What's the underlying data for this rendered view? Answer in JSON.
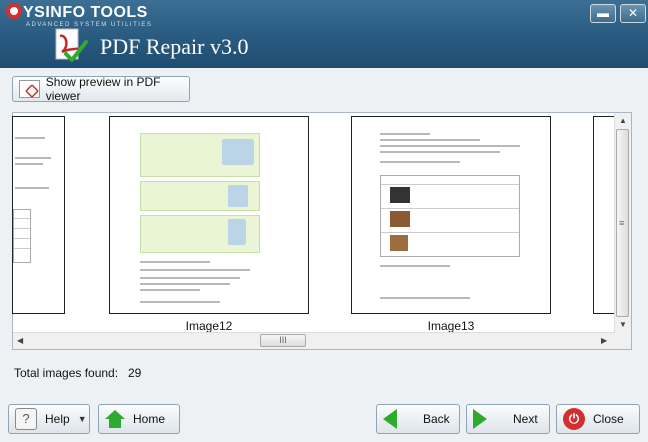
{
  "header": {
    "brand": "YSINFO TOOLS",
    "tagline": "ADVANCED SYSTEM UTILITIES",
    "app_title": "PDF Repair v3.0",
    "minimize_glyph": "▬",
    "close_glyph": "✕"
  },
  "toolbar": {
    "preview_label": "Show preview in PDF viewer",
    "preview_icon": "pdf-icon"
  },
  "viewer": {
    "thumbnails": [
      {
        "label": "Image12"
      },
      {
        "label": "Image13"
      }
    ],
    "scroll_h_grip": "III",
    "scroll_v_grip": "≡"
  },
  "summary": {
    "total_label": "Total images found:",
    "total_value": "29"
  },
  "footer": {
    "help_label": "Help",
    "home_label": "Home",
    "back_label": "Back",
    "next_label": "Next",
    "close_label": "Close"
  },
  "colors": {
    "header_blue": "#27597e",
    "accent_green": "#2eaa2e",
    "close_red": "#d32f2f"
  }
}
